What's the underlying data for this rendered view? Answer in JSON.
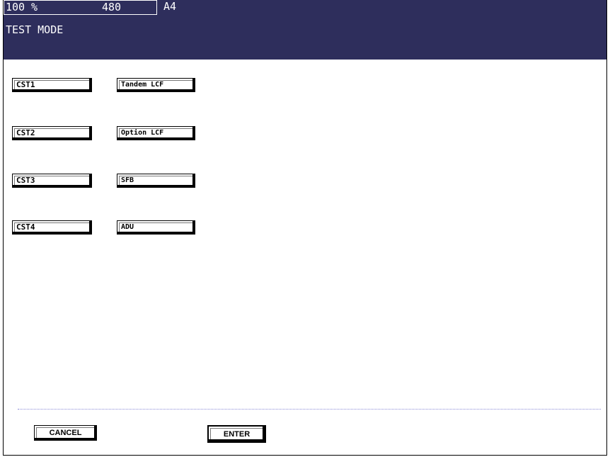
{
  "status": {
    "zoom": "100",
    "zoom_unit": "%",
    "count": "480",
    "paper": "A4"
  },
  "title": "TEST MODE",
  "buttons_left": [
    "CST1",
    "CST2",
    "CST3",
    "CST4"
  ],
  "buttons_right": [
    "Tandem LCF",
    "Option LCF",
    "SFB",
    "ADU"
  ],
  "footer": {
    "cancel_label": "CANCEL",
    "enter_label": "ENTER"
  }
}
